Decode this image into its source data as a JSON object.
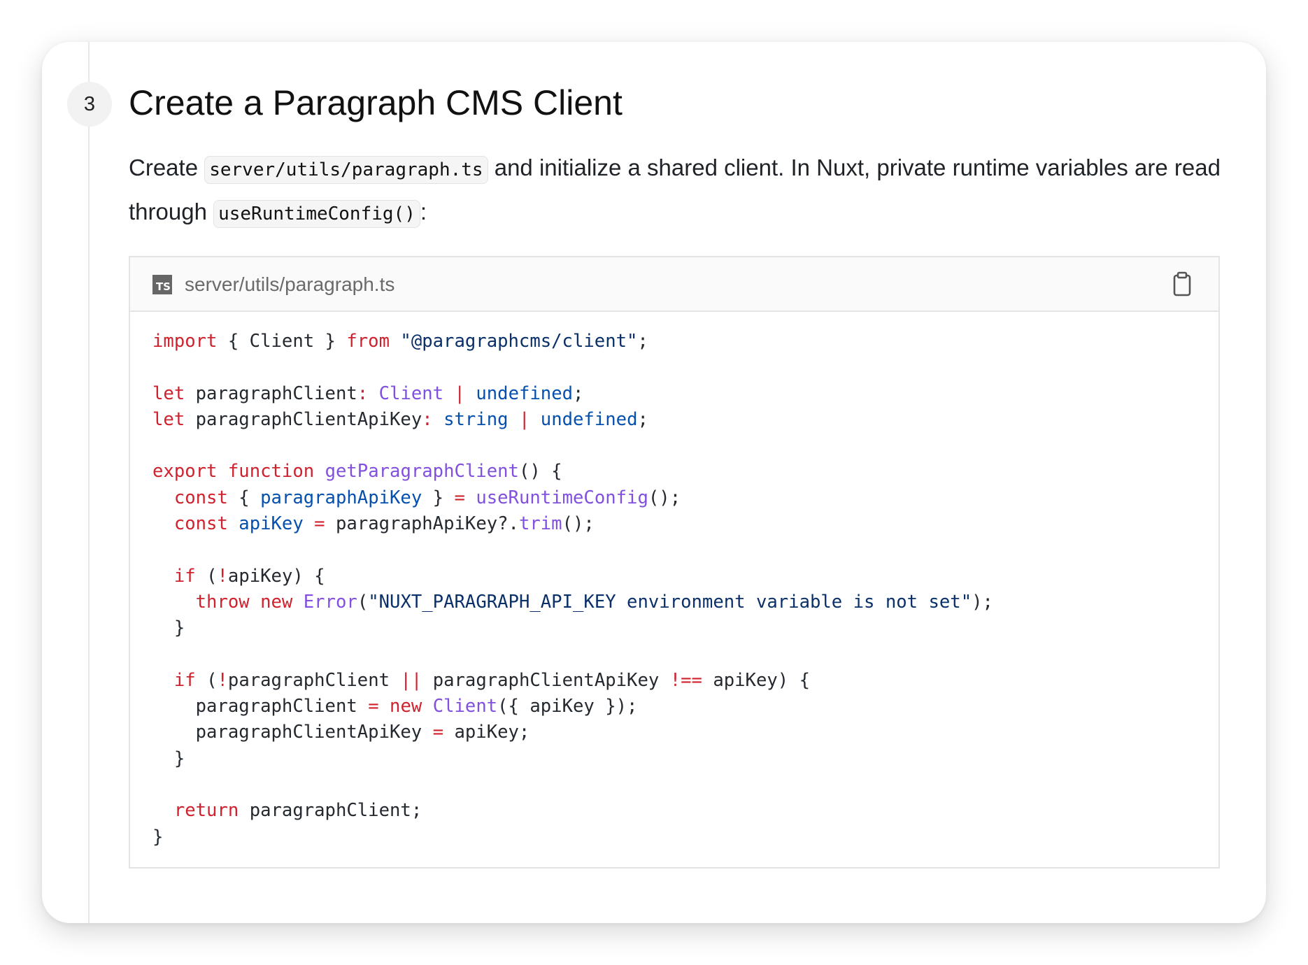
{
  "step": {
    "number": "3",
    "title": "Create a Paragraph CMS Client",
    "description": {
      "text_1": "Create ",
      "code_1": "server/utils/paragraph.ts",
      "text_2": " and initialize a shared client. In Nuxt, private runtime variables are read through ",
      "code_2": "useRuntimeConfig()",
      "text_3": ":"
    }
  },
  "code_block": {
    "language_icon": "TS",
    "file_name": "server/utils/paragraph.ts",
    "copy_icon": "clipboard-icon",
    "lines": [
      [
        {
          "c": "k",
          "t": "import"
        },
        {
          "c": "p",
          "t": " { Client } "
        },
        {
          "c": "k",
          "t": "from"
        },
        {
          "c": "p",
          "t": " "
        },
        {
          "c": "s",
          "t": "\"@paragraphcms/client\""
        },
        {
          "c": "p",
          "t": ";"
        }
      ],
      [],
      [
        {
          "c": "k",
          "t": "let"
        },
        {
          "c": "p",
          "t": " paragraphClient"
        },
        {
          "c": "k",
          "t": ":"
        },
        {
          "c": "p",
          "t": " "
        },
        {
          "c": "f",
          "t": "Client"
        },
        {
          "c": "p",
          "t": " "
        },
        {
          "c": "k",
          "t": "|"
        },
        {
          "c": "p",
          "t": " "
        },
        {
          "c": "t",
          "t": "undefined"
        },
        {
          "c": "p",
          "t": ";"
        }
      ],
      [
        {
          "c": "k",
          "t": "let"
        },
        {
          "c": "p",
          "t": " paragraphClientApiKey"
        },
        {
          "c": "k",
          "t": ":"
        },
        {
          "c": "p",
          "t": " "
        },
        {
          "c": "t",
          "t": "string"
        },
        {
          "c": "p",
          "t": " "
        },
        {
          "c": "k",
          "t": "|"
        },
        {
          "c": "p",
          "t": " "
        },
        {
          "c": "t",
          "t": "undefined"
        },
        {
          "c": "p",
          "t": ";"
        }
      ],
      [],
      [
        {
          "c": "k",
          "t": "export"
        },
        {
          "c": "p",
          "t": " "
        },
        {
          "c": "k",
          "t": "function"
        },
        {
          "c": "p",
          "t": " "
        },
        {
          "c": "f",
          "t": "getParagraphClient"
        },
        {
          "c": "p",
          "t": "() {"
        }
      ],
      [
        {
          "c": "p",
          "t": "  "
        },
        {
          "c": "k",
          "t": "const"
        },
        {
          "c": "p",
          "t": " { "
        },
        {
          "c": "t",
          "t": "paragraphApiKey"
        },
        {
          "c": "p",
          "t": " } "
        },
        {
          "c": "k",
          "t": "="
        },
        {
          "c": "p",
          "t": " "
        },
        {
          "c": "f",
          "t": "useRuntimeConfig"
        },
        {
          "c": "p",
          "t": "();"
        }
      ],
      [
        {
          "c": "p",
          "t": "  "
        },
        {
          "c": "k",
          "t": "const"
        },
        {
          "c": "p",
          "t": " "
        },
        {
          "c": "t",
          "t": "apiKey"
        },
        {
          "c": "p",
          "t": " "
        },
        {
          "c": "k",
          "t": "="
        },
        {
          "c": "p",
          "t": " paragraphApiKey?."
        },
        {
          "c": "f",
          "t": "trim"
        },
        {
          "c": "p",
          "t": "();"
        }
      ],
      [],
      [
        {
          "c": "p",
          "t": "  "
        },
        {
          "c": "k",
          "t": "if"
        },
        {
          "c": "p",
          "t": " ("
        },
        {
          "c": "k",
          "t": "!"
        },
        {
          "c": "p",
          "t": "apiKey) {"
        }
      ],
      [
        {
          "c": "p",
          "t": "    "
        },
        {
          "c": "k",
          "t": "throw"
        },
        {
          "c": "p",
          "t": " "
        },
        {
          "c": "k",
          "t": "new"
        },
        {
          "c": "p",
          "t": " "
        },
        {
          "c": "f",
          "t": "Error"
        },
        {
          "c": "p",
          "t": "("
        },
        {
          "c": "s",
          "t": "\"NUXT_PARAGRAPH_API_KEY environment variable is not set\""
        },
        {
          "c": "p",
          "t": ");"
        }
      ],
      [
        {
          "c": "p",
          "t": "  }"
        }
      ],
      [],
      [
        {
          "c": "p",
          "t": "  "
        },
        {
          "c": "k",
          "t": "if"
        },
        {
          "c": "p",
          "t": " ("
        },
        {
          "c": "k",
          "t": "!"
        },
        {
          "c": "p",
          "t": "paragraphClient "
        },
        {
          "c": "k",
          "t": "||"
        },
        {
          "c": "p",
          "t": " paragraphClientApiKey "
        },
        {
          "c": "k",
          "t": "!=="
        },
        {
          "c": "p",
          "t": " apiKey) {"
        }
      ],
      [
        {
          "c": "p",
          "t": "    paragraphClient "
        },
        {
          "c": "k",
          "t": "="
        },
        {
          "c": "p",
          "t": " "
        },
        {
          "c": "k",
          "t": "new"
        },
        {
          "c": "p",
          "t": " "
        },
        {
          "c": "f",
          "t": "Client"
        },
        {
          "c": "p",
          "t": "({ apiKey });"
        }
      ],
      [
        {
          "c": "p",
          "t": "    paragraphClientApiKey "
        },
        {
          "c": "k",
          "t": "="
        },
        {
          "c": "p",
          "t": " apiKey;"
        }
      ],
      [
        {
          "c": "p",
          "t": "  }"
        }
      ],
      [],
      [
        {
          "c": "p",
          "t": "  "
        },
        {
          "c": "k",
          "t": "return"
        },
        {
          "c": "p",
          "t": " paragraphClient;"
        }
      ],
      [
        {
          "c": "p",
          "t": "}"
        }
      ]
    ]
  },
  "colors": {
    "keyword": "#cf222e",
    "type": "#0550ae",
    "function": "#8250df",
    "string": "#0a3069",
    "text": "#24292f"
  }
}
